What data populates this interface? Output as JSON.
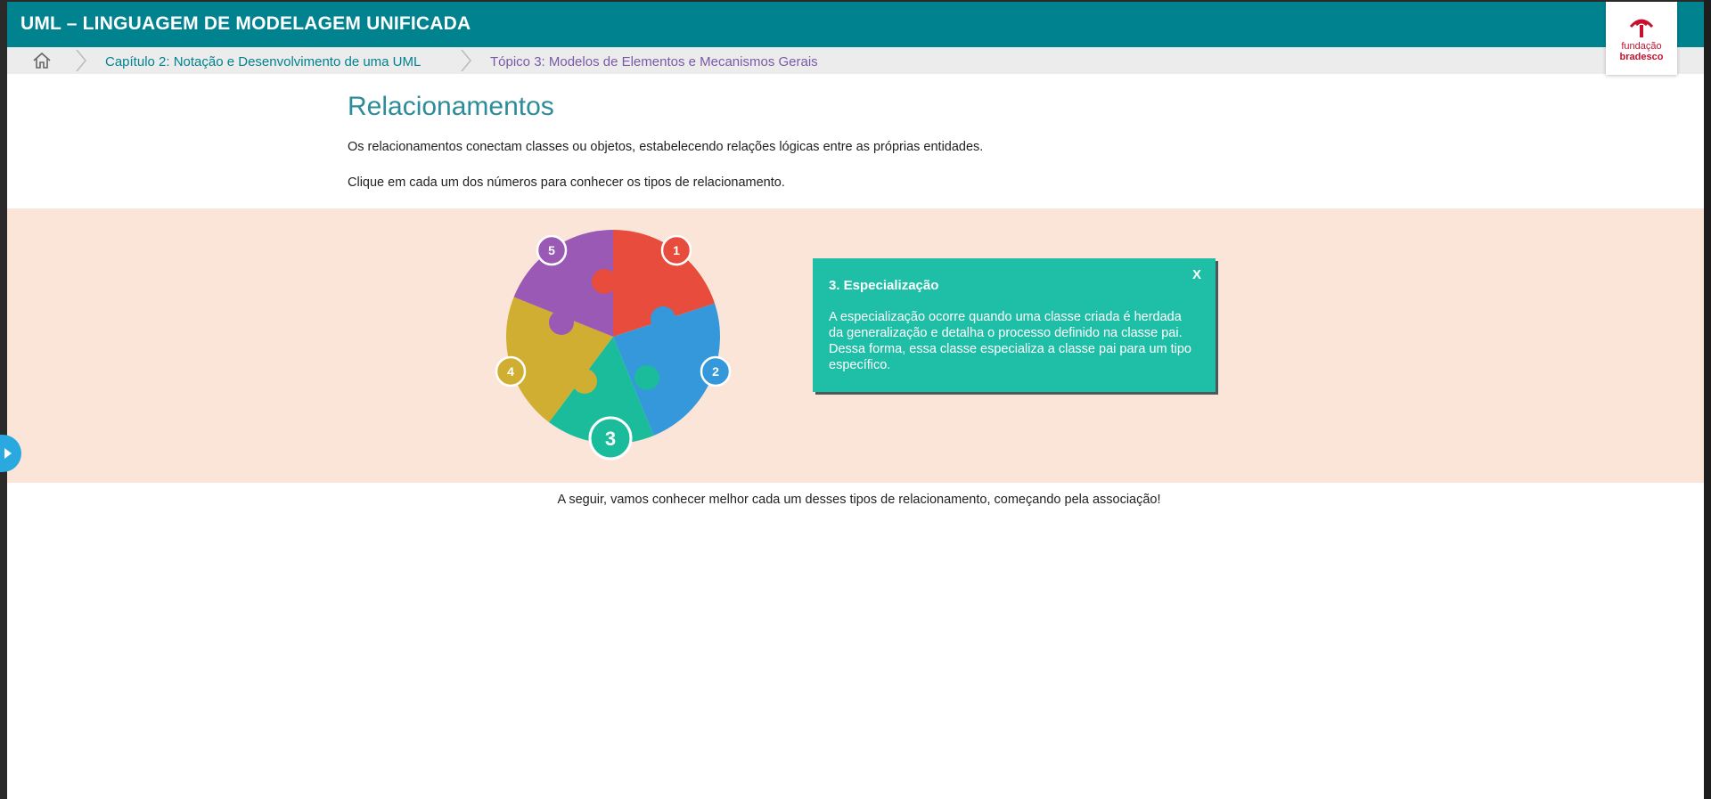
{
  "header": {
    "app_title": "UML – LINGUAGEM DE MODELAGEM UNIFICADA",
    "logo_line1": "fundação",
    "logo_line2": "bradesco",
    "bg_color": "#00838f"
  },
  "breadcrumb": {
    "home_icon": "home-icon",
    "items": [
      {
        "label": "Capítulo 2: Notação e Desenvolvimento de uma UML"
      },
      {
        "label": "Tópico 3: Modelos de Elementos e Mecanismos Gerais"
      }
    ]
  },
  "content": {
    "title": "Relacionamentos",
    "intro": "Os relacionamentos conectam classes ou objetos, estabelecendo relações lógicas entre as próprias entidades.",
    "instruction": "Clique em cada um dos números para conhecer os tipos de relacionamento.",
    "footer": "A seguir, vamos conhecer melhor cada um desses tipos de relacionamento, começando pela associação!"
  },
  "puzzle": {
    "pieces": [
      {
        "number": "1",
        "color": "#e84c3d"
      },
      {
        "number": "2",
        "color": "#3498db"
      },
      {
        "number": "3",
        "color": "#1abc9c",
        "active": true
      },
      {
        "number": "4",
        "color": "#cfae32"
      },
      {
        "number": "5",
        "color": "#9b59b6"
      }
    ]
  },
  "popup": {
    "title": "3. Especialização",
    "close_label": "X",
    "body": "A especialização ocorre quando uma classe criada é herdada da generalização e detalha o processo definido na classe pai. Dessa forma, essa classe especializa a classe pai para um tipo específico.",
    "bg_color": "#1fbfa7"
  },
  "colors": {
    "band": "#fae5d8",
    "title": "#2c8c99",
    "crumb_active": "#7a5aa6"
  }
}
